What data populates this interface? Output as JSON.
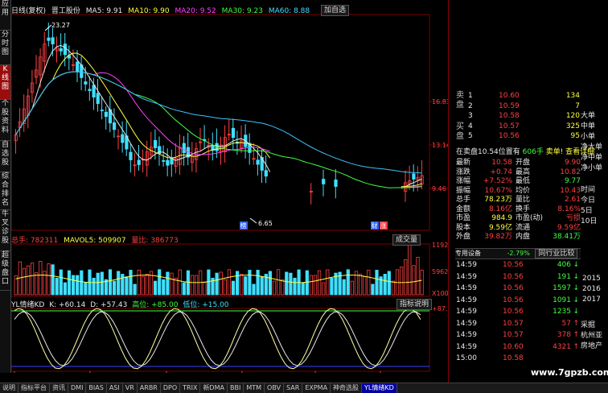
{
  "side_tabs": [
    "应用",
    "分时图",
    "K线图",
    "个股资料",
    "自选股",
    "综合排名",
    "牛叉诊股",
    "超级盘口"
  ],
  "header": {
    "period": "日线(复权)",
    "stock": "晋工股份",
    "ma5": "MA5: 9.91",
    "ma10": "MA10: 9.90",
    "ma20": "MA20: 9.52",
    "ma30": "MA30: 9.23",
    "ma60": "MA60: 8.88",
    "add_button": "加自选"
  },
  "price_axis": [
    "16.83",
    "13.14",
    "9.46"
  ],
  "price_annotations": {
    "high": "23.27",
    "low": "6.65"
  },
  "volume_header": {
    "total": "总手: 782311",
    "mavol5": "MAVOL5: 509907",
    "ratio": "量比: 386773"
  },
  "volume_button": "成交量",
  "volume_axis": [
    "11924",
    "5962",
    "X100"
  ],
  "kd_header": {
    "name": "YL情绪KD",
    "k": "K: +60.14",
    "d": "D: +57.43",
    "high": "高位: +85.00",
    "low": "低位: +15.00"
  },
  "kd_button": "指标说明",
  "kd_axis": "+87.93",
  "chart_tags": [
    "榜",
    "财",
    "涨"
  ],
  "date_axis": [
    "06",
    "07",
    "08",
    "09",
    "10",
    "11"
  ],
  "order_book": {
    "sell_label": "卖盘",
    "buy_label": "买盘",
    "rows": [
      {
        "level": "1",
        "price": "10.60",
        "volume": "134"
      },
      {
        "level": "2",
        "price": "10.59",
        "volume": "7"
      },
      {
        "level": "3",
        "price": "10.58",
        "volume": "120"
      },
      {
        "level": "4",
        "price": "10.57",
        "volume": "325"
      },
      {
        "level": "5",
        "price": "10.56",
        "volume": "95"
      }
    ]
  },
  "order_types": [
    "大单",
    "中单",
    "小单",
    "净大单",
    "净中单",
    "净小单"
  ],
  "time_axis": [
    "时间",
    "今日",
    "5日",
    "10日"
  ],
  "years": [
    "2015",
    "2016",
    "2017"
  ],
  "bid_note": "在卖盘10.54位置有",
  "bid_volume": "606手",
  "bid_link": "卖单! 查看详细",
  "quote": [
    {
      "l1": "最新",
      "v1": "10.58",
      "l2": "开盘",
      "v2": "9.90"
    },
    {
      "l1": "涨跌",
      "v1": "+0.74",
      "l2": "最高",
      "v2": "10.82"
    },
    {
      "l1": "涨幅",
      "v1": "+7.52%",
      "l2": "最低",
      "v2": "9.77"
    },
    {
      "l1": "振幅",
      "v1": "10.67%",
      "l2": "均价",
      "v2": "10.43"
    },
    {
      "l1": "总手",
      "v1": "78.23万",
      "l2": "量比",
      "v2": "2.61"
    },
    {
      "l1": "金额",
      "v1": "8.16亿",
      "l2": "换手",
      "v2": "8.16%"
    },
    {
      "l1": "市盈",
      "v1": "984.9",
      "l2": "市盈(动)",
      "v2": "亏损"
    },
    {
      "l1": "股本",
      "v1": "9.59亿",
      "l2": "流通",
      "v2": "9.59亿"
    },
    {
      "l1": "外盘",
      "v1": "39.82万",
      "l2": "内盘",
      "v2": "38.41万"
    }
  ],
  "sector": {
    "name": "专用设备",
    "change": "-2.79%",
    "link": "同行业比较"
  },
  "ticks": [
    {
      "time": "14:59",
      "price": "10.56",
      "vol": "406",
      "dir": "down"
    },
    {
      "time": "14:59",
      "price": "10.56",
      "vol": "191",
      "dir": "down"
    },
    {
      "time": "14:59",
      "price": "10.56",
      "vol": "1597",
      "dir": "down"
    },
    {
      "time": "14:59",
      "price": "10.56",
      "vol": "1091",
      "dir": "down"
    },
    {
      "time": "14:59",
      "price": "10.56",
      "vol": "1235",
      "dir": "down"
    },
    {
      "time": "14:59",
      "price": "10.57",
      "vol": "57",
      "dir": "up"
    },
    {
      "time": "14:59",
      "price": "10.57",
      "vol": "378",
      "dir": "up"
    },
    {
      "time": "14:59",
      "price": "10.60",
      "vol": "4321",
      "dir": "up"
    },
    {
      "time": "15:00",
      "price": "10.58",
      "vol": "",
      "dir": "none"
    }
  ],
  "sector_list": [
    "采掘",
    "杭州亚",
    "房地产"
  ],
  "bottom_tabs": [
    "说明",
    "指标平台",
    "资讯",
    "DMI",
    "BIAS",
    "ASI",
    "VR",
    "ARBR",
    "DPO",
    "TRIX",
    "新DMA",
    "BBI",
    "MTM",
    "OBV",
    "SAR",
    "EXPMA",
    "神奇选股",
    "YL情绪KD"
  ],
  "watermark": "www.7gpzb.com",
  "colors": {
    "up": "#ff4040",
    "down": "#40ff40",
    "ma5": "#e8e8e8",
    "ma10": "#ffff40",
    "ma20": "#ff40ff",
    "ma30": "#40ff40",
    "ma60": "#40c0ff",
    "vol_down": "#40e0ff"
  }
}
